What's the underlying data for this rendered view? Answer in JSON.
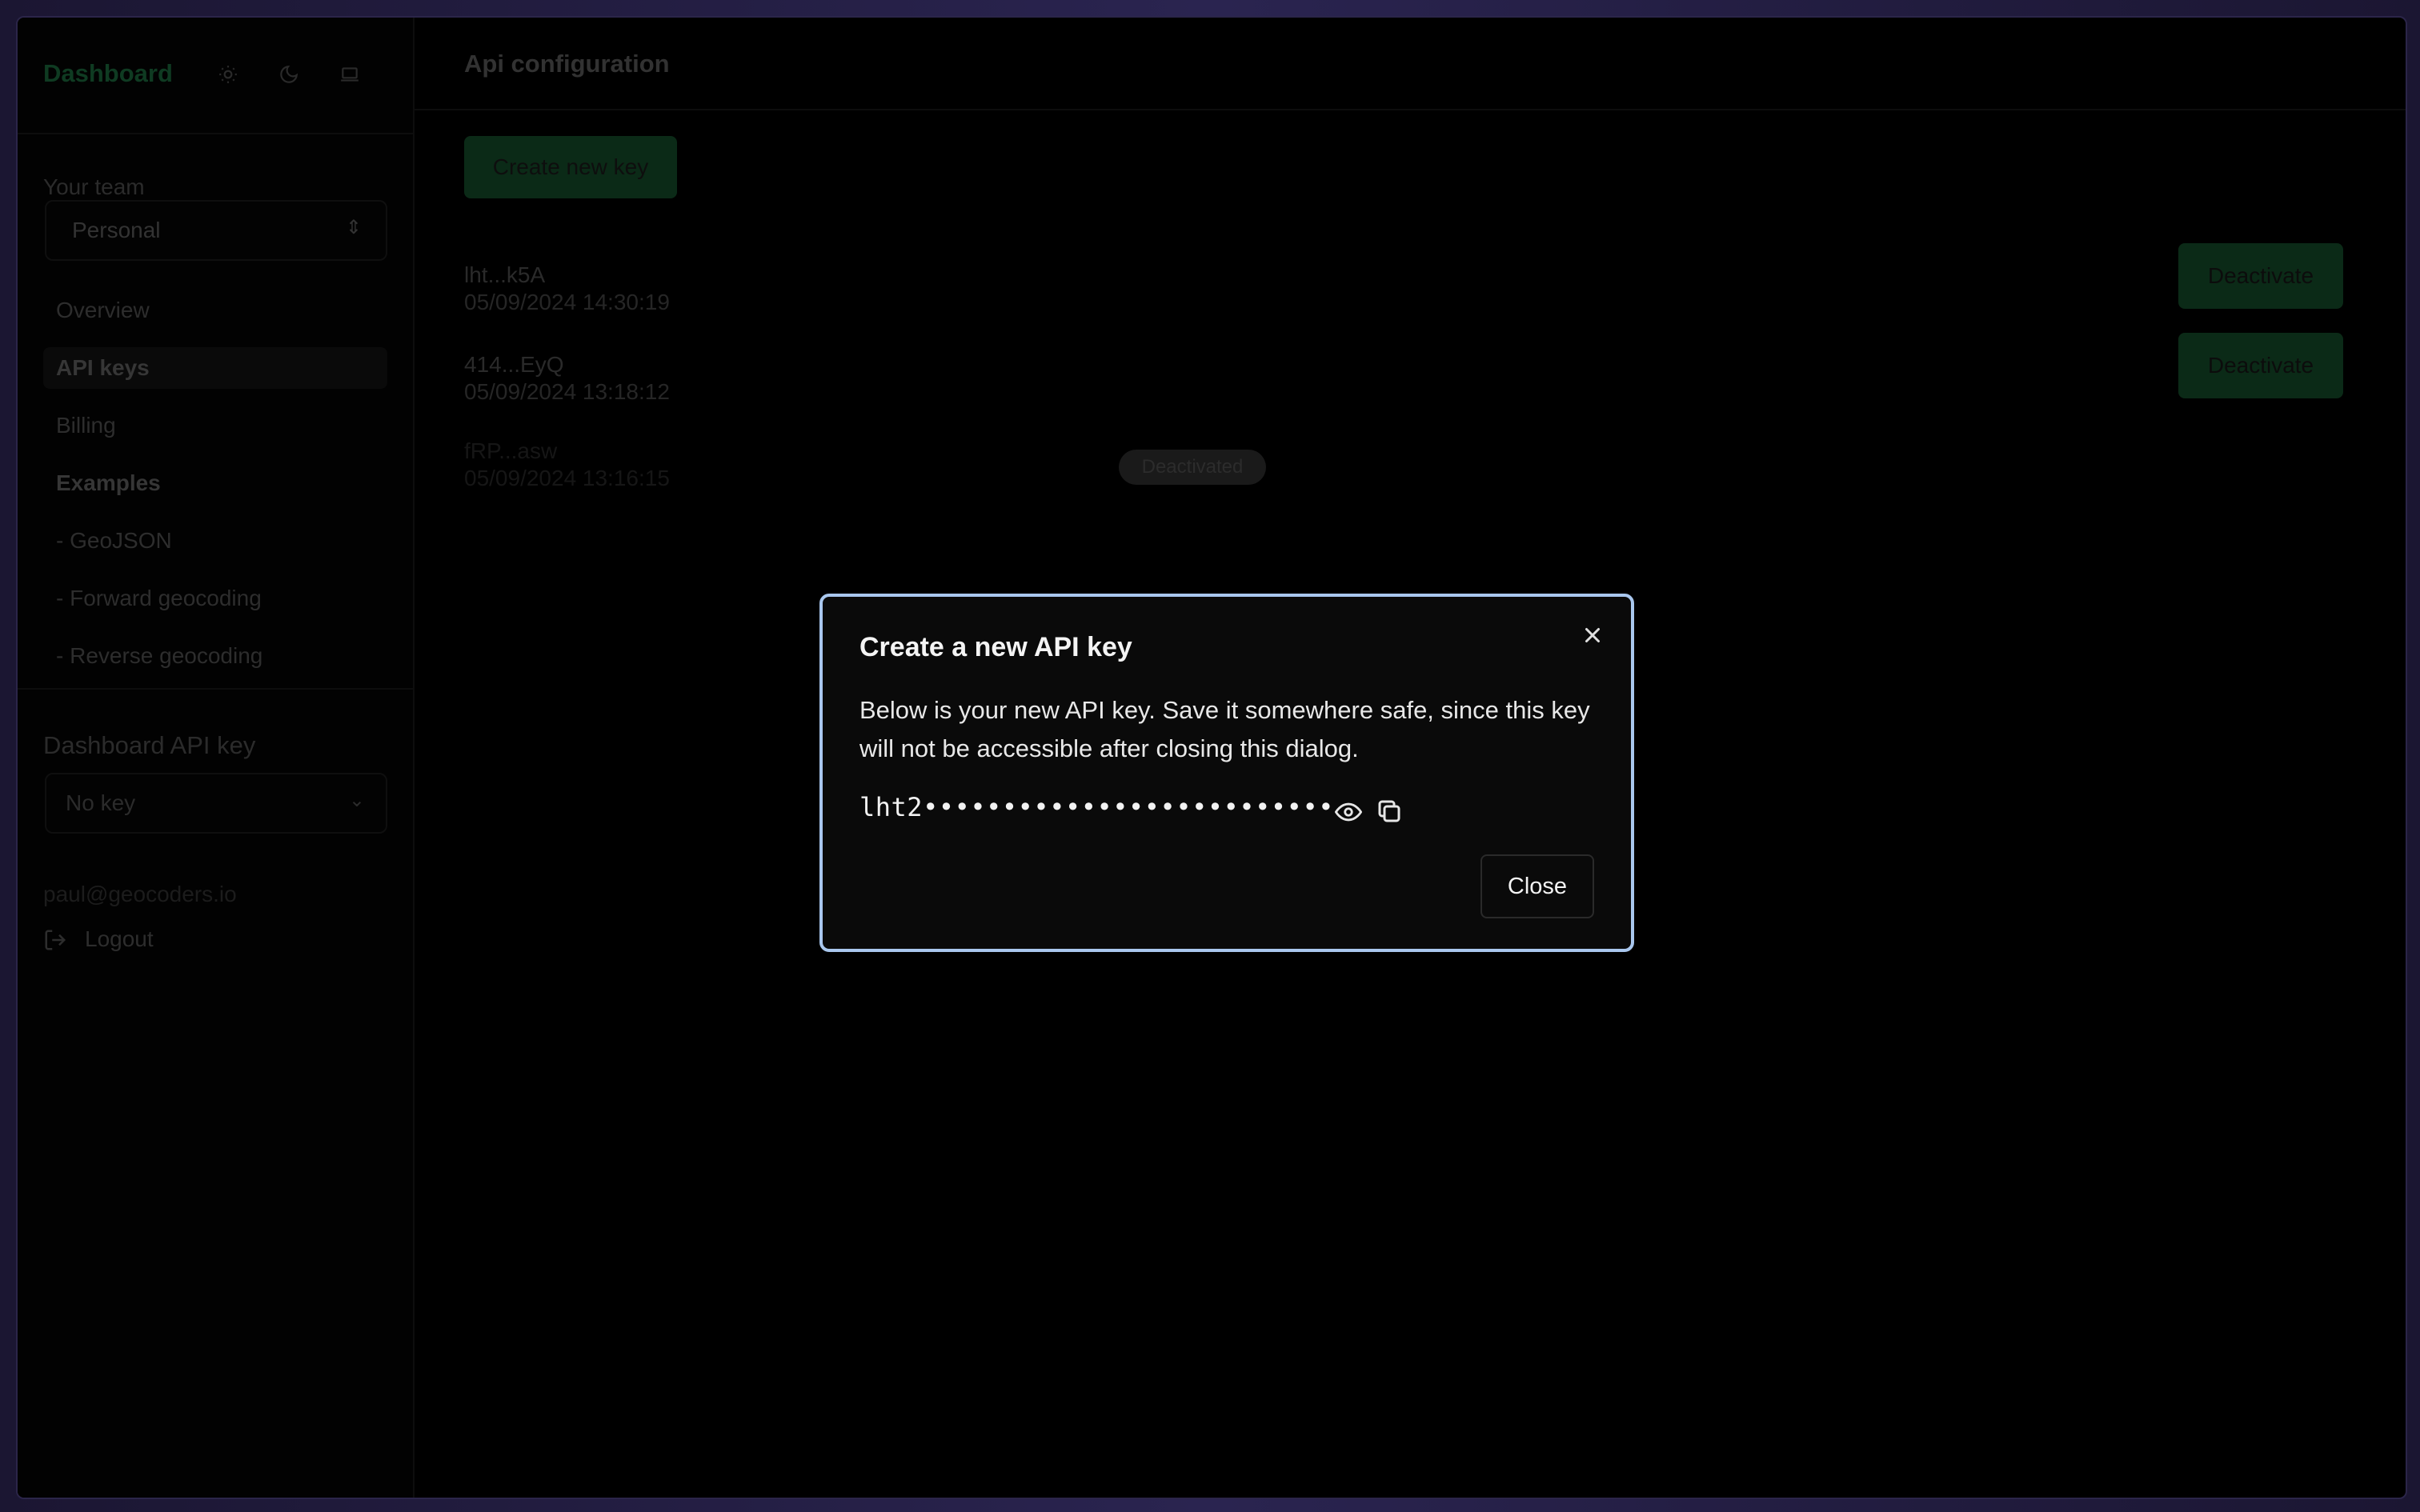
{
  "sidebar": {
    "brand": "Dashboard",
    "team_label": "Your team",
    "team_value": "Personal",
    "nav": [
      {
        "label": "Overview"
      },
      {
        "label": "API keys"
      },
      {
        "label": "Billing"
      },
      {
        "label": "Examples"
      },
      {
        "label": "- GeoJSON"
      },
      {
        "label": "- Forward geocoding"
      },
      {
        "label": "- Reverse geocoding"
      }
    ],
    "dashboard_key_label": "Dashboard API key",
    "dashboard_key_value": "No key",
    "email": "paul@geocoders.io",
    "logout_label": "Logout"
  },
  "main": {
    "title": "Api configuration",
    "create_button": "Create new key",
    "keys": [
      {
        "name": "lht...k5A",
        "date": "05/09/2024 14:30:19",
        "action": "Deactivate"
      },
      {
        "name": "414...EyQ",
        "date": "05/09/2024 13:18:12",
        "action": "Deactivate"
      },
      {
        "name": "fRP...asw",
        "date": "05/09/2024 13:16:15",
        "badge": "Deactivated"
      }
    ]
  },
  "modal": {
    "title": "Create a new API key",
    "description": "Below is your new API key. Save it somewhere safe, since this key will not be accessible after closing this dialog.",
    "key_masked": "lht2••••••••••••••••••••••••••",
    "close_button": "Close"
  },
  "colors": {
    "modal_border": "#a9c7ee",
    "brand_green": "#0f3b22",
    "button_green": "#0b2a17"
  }
}
